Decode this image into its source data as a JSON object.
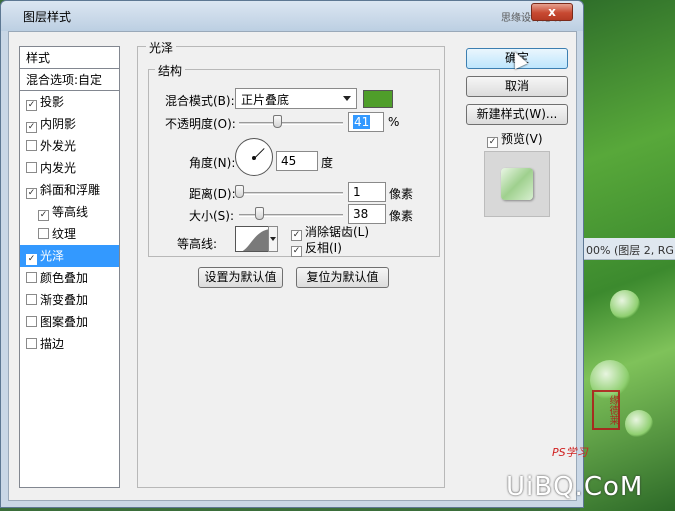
{
  "window": {
    "title": "图层样式",
    "site_text": "思缘设计论坛",
    "close_label": "x"
  },
  "styles_list": {
    "header": "样式",
    "blend_options": "混合选项:自定",
    "items": [
      {
        "label": "投影",
        "checked": true
      },
      {
        "label": "内阴影",
        "checked": true
      },
      {
        "label": "外发光",
        "checked": false
      },
      {
        "label": "内发光",
        "checked": false
      },
      {
        "label": "斜面和浮雕",
        "checked": true
      },
      {
        "label": "等高线",
        "checked": true,
        "indent": true
      },
      {
        "label": "纹理",
        "checked": false,
        "indent": true
      },
      {
        "label": "光泽",
        "checked": true,
        "selected": true
      },
      {
        "label": "颜色叠加",
        "checked": false
      },
      {
        "label": "渐变叠加",
        "checked": false
      },
      {
        "label": "图案叠加",
        "checked": false
      },
      {
        "label": "描边",
        "checked": false
      }
    ]
  },
  "satin": {
    "title": "光泽",
    "structure_title": "结构",
    "blend_mode_label": "混合模式(B):",
    "blend_mode_value": "正片叠底",
    "color": "#4f9e2a",
    "opacity_label": "不透明度(O):",
    "opacity_value": "41",
    "opacity_unit": "%",
    "angle_label": "角度(N):",
    "angle_value": "45",
    "angle_unit": "度",
    "distance_label": "距离(D):",
    "distance_value": "1",
    "distance_unit": "像素",
    "size_label": "大小(S):",
    "size_value": "38",
    "size_unit": "像素",
    "contour_label": "等高线:",
    "antialias_label": "消除锯齿(L)",
    "antialias_checked": true,
    "invert_label": "反相(I)",
    "invert_checked": true,
    "make_default": "设置为默认值",
    "reset_default": "复位为默认值"
  },
  "buttons": {
    "ok": "确定",
    "cancel": "取消",
    "new_style": "新建样式(W)...",
    "preview_label": "预览(V)",
    "preview_checked": true
  },
  "background": {
    "doc_tab": "00% (图层 2, RG",
    "seal_text": "缘德莱",
    "ps_mark": "PS学习",
    "watermark": "UiBQ.CoM"
  }
}
